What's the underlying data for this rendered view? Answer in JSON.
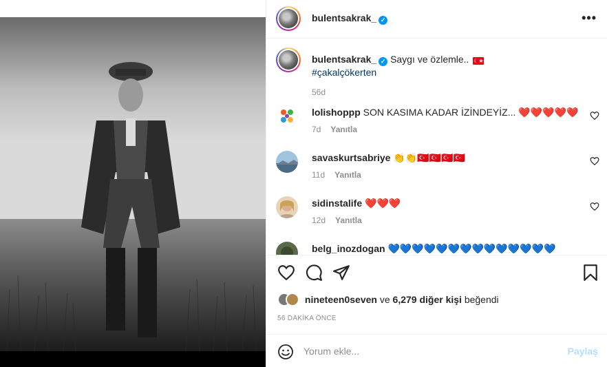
{
  "post": {
    "username": "bulentsakrak_",
    "verified_mark": "✓",
    "more_icon": "more-horizontal-icon"
  },
  "caption": {
    "username": "bulentsakrak_",
    "text": "Saygı ve özlemle..",
    "hashtag": "#çakalçökerten",
    "time": "56d"
  },
  "comments": [
    {
      "username": "lolishoppp",
      "text": "SON KASIMA KADAR İZİNDEYİZ...",
      "emoji": "❤️❤️❤️❤️❤️",
      "time": "7d",
      "reply": "Yanıtla"
    },
    {
      "username": "savaskurtsabriye",
      "text": "",
      "emoji": "👏👏🇹🇷🇹🇷🇹🇷🇹🇷",
      "time": "11d",
      "reply": "Yanıtla"
    },
    {
      "username": "sidinstalife",
      "text": "",
      "emoji": "❤️❤️❤️",
      "time": "12d",
      "reply": "Yanıtla"
    },
    {
      "username": "belg_inozdogan",
      "text": "",
      "emoji": "💙💙💙💙💙💙💙💙💙💙💙💙💙💙",
      "time": "",
      "reply": ""
    }
  ],
  "likes": {
    "first_liker": "nineteen0seven",
    "connector": "ve",
    "others": "6,279 diğer kişi",
    "suffix": "beğendi"
  },
  "post_time": "56 DAKİKA ÖNCE",
  "add_comment": {
    "placeholder": "Yorum ekle...",
    "post_label": "Paylaş"
  },
  "colors": {
    "verified": "#0095f6",
    "hashtag": "#00376b",
    "muted": "#8e8e8e",
    "post_disabled": "#b2dffc",
    "heart": "#ed1b24",
    "blue_heart": "#1d7bf0"
  }
}
